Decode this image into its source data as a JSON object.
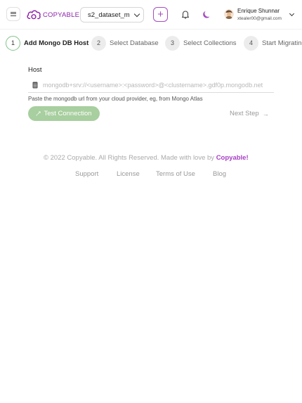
{
  "header": {
    "brand_name": "COPYABLE",
    "brand_color": "#8e24aa",
    "dataset": {
      "selected": "s2_dataset_m"
    },
    "add_label": "+",
    "user": {
      "name": "Enrique Shunnar",
      "email": "xtealer00@gmail.com"
    },
    "icons": {
      "menu": "hamburger-icon",
      "bell": "bell-icon",
      "theme": "moon-icon",
      "dropdown": "chevron-down-icon"
    }
  },
  "stepper": {
    "steps": [
      {
        "number": "1",
        "label": "Add Mongo DB Host",
        "active": true
      },
      {
        "number": "2",
        "label": "Select Database",
        "active": false
      },
      {
        "number": "3",
        "label": "Select Collections",
        "active": false
      },
      {
        "number": "4",
        "label": "Start Migrating",
        "active": false
      }
    ],
    "active_color": "#7fc48a"
  },
  "form": {
    "host_label": "Host",
    "host_value": "",
    "host_placeholder": "mongodb+srv://<username>:<password>@<clustername>.gdf0p.mongodb.net",
    "helper_text": "Paste the mongodb url from your cloud provider, eg, from Mongo Atlas",
    "test_button_label": "Test Connection",
    "test_button_color": "#a8cf9f",
    "next_step_label": "Next Step",
    "next_step_arrow": "→"
  },
  "footer": {
    "copyright_prefix": "© 2022  Copyable. All Rights Reserved. Made with love by ",
    "copyright_brand": "Copyable!",
    "links": [
      "Support",
      "License",
      "Terms of Use",
      "Blog"
    ]
  }
}
